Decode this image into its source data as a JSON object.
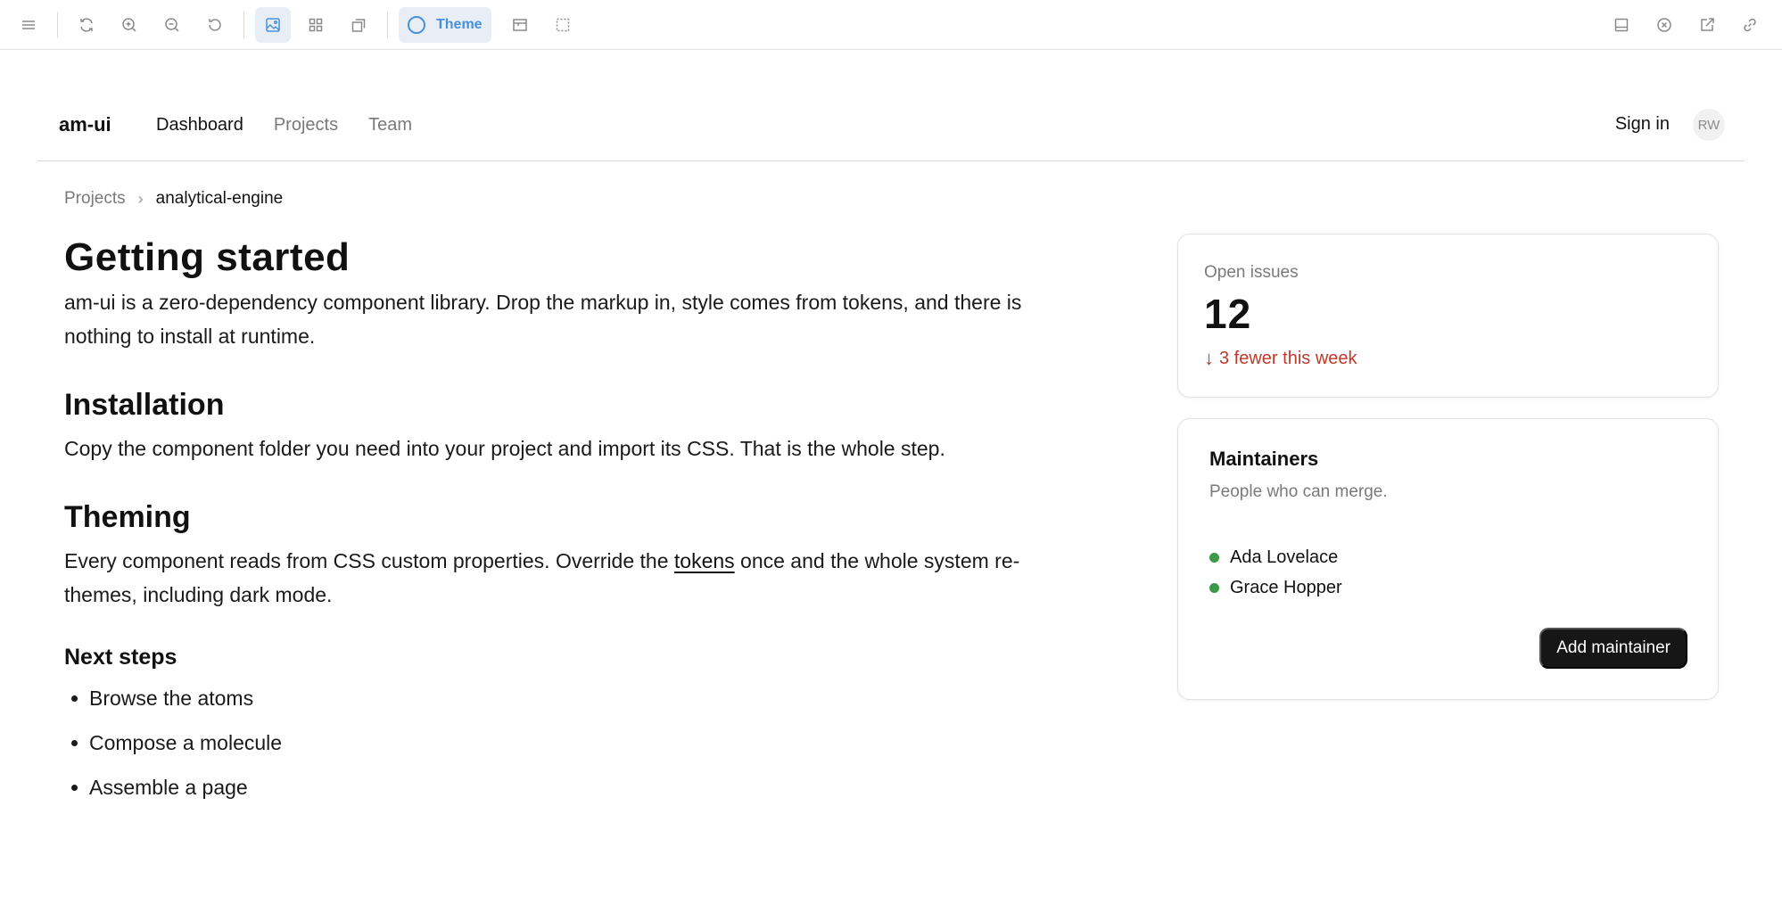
{
  "toolbar": {
    "left_icons": [
      "menu-icon",
      "refresh-icon",
      "zoom-in-icon",
      "zoom-out-icon",
      "reset-icon",
      "image-icon",
      "grid-icon",
      "copy-icon"
    ],
    "theme_label": "Theme",
    "right_icons": [
      "panel-icon",
      "close-circle-icon",
      "external-link-icon",
      "link-icon"
    ]
  },
  "header": {
    "brand": "am-ui",
    "nav": [
      "Dashboard",
      "Projects",
      "Team"
    ],
    "sign_in": "Sign in",
    "avatar_initials": "RW"
  },
  "breadcrumb": {
    "parent": "Projects",
    "current": "analytical-engine"
  },
  "content": {
    "title": "Getting started",
    "intro_line1": "am-ui is a zero-dependency component library. Drop the markup in, style comes from tokens, and there is",
    "intro_line2": "nothing to install at runtime.",
    "installation_heading": "Installation",
    "installation_text": "Copy the component folder you need into your project and import its CSS. That is the whole step.",
    "theming_heading": "Theming",
    "theming_before": "Every component reads from CSS custom properties. Override the ",
    "theming_link": "tokens",
    "theming_after": " once and the whole system re-",
    "theming_line2": "themes, including dark mode.",
    "next_heading": "Next steps",
    "next_steps": [
      "Browse the atoms",
      "Compose a molecule",
      "Assemble a page"
    ]
  },
  "issues_card": {
    "label": "Open issues",
    "value": "12",
    "delta": "3 fewer this week",
    "delta_color": "#c0392b"
  },
  "maintainers_card": {
    "title": "Maintainers",
    "subtitle": "People who can merge.",
    "people": [
      "Ada Lovelace",
      "Grace Hopper"
    ],
    "status_color": "#3a9a4a",
    "button": "Add maintainer"
  }
}
